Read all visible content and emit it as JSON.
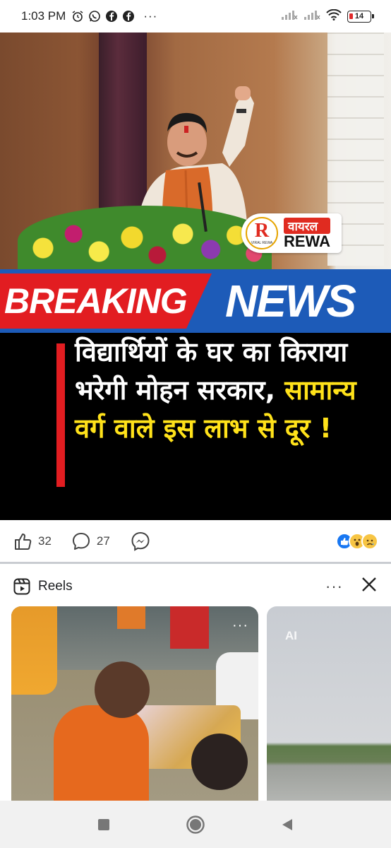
{
  "status_bar": {
    "time": "1:03 PM",
    "left_icons": [
      "alarm-icon",
      "whatsapp-icon",
      "facebook-icon",
      "facebook-icon"
    ],
    "more": "···",
    "battery": "14"
  },
  "post": {
    "logo": {
      "mark_letter": "R",
      "mark_sub": "VIRAL REWA",
      "top": "वायरल",
      "bottom": "REWA"
    },
    "breaking_word": "BREAKING",
    "news_word": "NEWS",
    "headline_white": "विद्यार्थियों के घर का किराया भरेगी मोहन सरकार,",
    "headline_yellow": "सामान्य वर्ग वाले इस लाभ से दूर !",
    "likes": "32",
    "comments": "27",
    "reactions": [
      "like-icon",
      "wow-icon",
      "sad-icon"
    ]
  },
  "reels": {
    "title": "Reels",
    "more": "···",
    "reel2_label": "AI"
  },
  "colors": {
    "breaking_red": "#e21d21",
    "news_blue": "#1d5bb8",
    "headline_yellow": "#ffe21a",
    "fb_blue": "#1877f2"
  }
}
